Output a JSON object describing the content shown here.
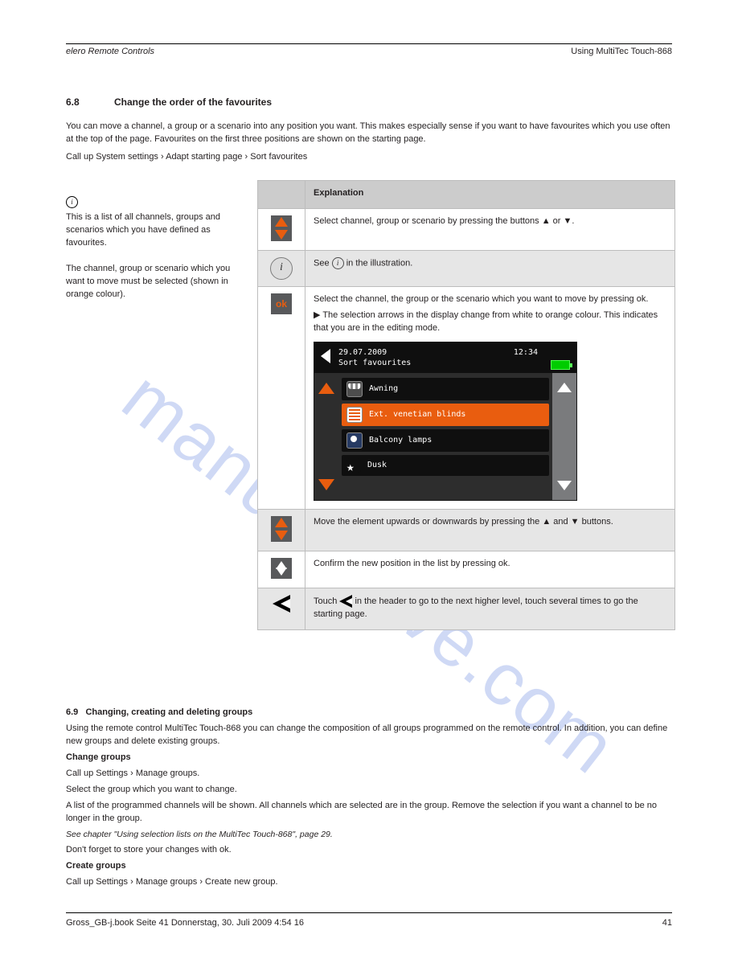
{
  "header": {
    "left_italic": "elero Remote Controls",
    "right": "Using MultiTec Touch-868"
  },
  "section": {
    "number": "6.8",
    "title": "Change the order of the favourites"
  },
  "intro": {
    "p1": "You can move a channel, a group or a scenario into any position you want. This makes especially sense if you want to have favourites which you use often at the top of the page. Favourites on the first three positions are shown on the starting page.",
    "p2": "Call up System settings › Adapt starting page › Sort favourites"
  },
  "note": {
    "p1": "This is a list of all channels, groups and scenarios which you have defined as favourites.",
    "p2": "The channel, group or scenario which you want to move must be selected (shown in orange colour)."
  },
  "table": {
    "head_icon": "",
    "head_expl": "Explanation",
    "rows": [
      {
        "text": "Select channel, group or scenario by pressing the buttons ▲ or ▼."
      },
      {
        "text_before": "See   ",
        "text_after": " in the illustration."
      },
      {
        "p1": "Select the channel, the group or the scenario which you want to move by pressing ok.",
        "p2": "▶ The selection arrows in the display change from white to orange colour. This indicates that you are in the editing mode."
      },
      {
        "text": "Move the element upwards or downwards by pressing the ▲ and ▼ buttons."
      },
      {
        "text": "Confirm the new position in the list by pressing ok."
      },
      {
        "text_before": "Touch   ",
        "text_after": "  in the header to go to the next higher level, touch several times to go the starting page."
      }
    ]
  },
  "screen": {
    "date": "29.07.2009",
    "time": "12:34",
    "title": "Sort favourites",
    "items": [
      {
        "label": "Awning",
        "icon": "awning"
      },
      {
        "label": "Ext. venetian blinds",
        "icon": "blinds",
        "selected": true
      },
      {
        "label": "Balcony lamps",
        "icon": "lamp"
      },
      {
        "label": "Dusk",
        "icon": "star"
      }
    ]
  },
  "sec69": {
    "number": "6.9",
    "title": "Changing, creating and deleting groups",
    "p1": "Using the remote control MultiTec Touch-868 you can change the composition of all groups programmed on the remote control. In addition, you can define new groups and delete existing groups.",
    "h2": "Change groups",
    "p2a": "Call up Settings › Manage groups.",
    "p2b": "Select the group which you want to change.",
    "p2c": "A list of the programmed channels will be shown. All channels which are selected are in the group. Remove the selection if you want a channel to be no longer in the group.",
    "ref": "See chapter \"Using selection lists on the MultiTec Touch-868\", page 29.",
    "p3": "Don't forget to store your changes with ok.",
    "h3": "Create groups",
    "p4": "Call up Settings › Manage groups › Create new group."
  },
  "footer": {
    "left": "Gross_GB-j.book  Seite 41  Donnerstag, 30. Juli 2009  4:54 16",
    "center": "",
    "right": "41"
  },
  "watermark": "manualshive.com"
}
